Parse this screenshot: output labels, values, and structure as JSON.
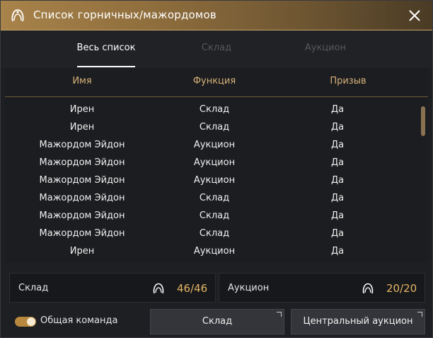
{
  "window": {
    "title": "Список горничных/мажордомов",
    "title_icon": "maid-icon",
    "close_icon": "close-icon"
  },
  "tabs": [
    {
      "label": "Весь список",
      "active": true
    },
    {
      "label": "Склад",
      "active": false
    },
    {
      "label": "Аукцион",
      "active": false
    }
  ],
  "table": {
    "headers": {
      "name": "Имя",
      "function": "Функция",
      "summon": "Призыв"
    },
    "rows": [
      {
        "name": "Ирен",
        "function": "Склад",
        "summon": "Да"
      },
      {
        "name": "Ирен",
        "function": "Склад",
        "summon": "Да"
      },
      {
        "name": "Мажордом Эйдон",
        "function": "Аукцион",
        "summon": "Да"
      },
      {
        "name": "Мажордом Эйдон",
        "function": "Аукцион",
        "summon": "Да"
      },
      {
        "name": "Мажордом Эйдон",
        "function": "Аукцион",
        "summon": "Да"
      },
      {
        "name": "Мажордом Эйдон",
        "function": "Склад",
        "summon": "Да"
      },
      {
        "name": "Мажордом Эйдон",
        "function": "Склад",
        "summon": "Да"
      },
      {
        "name": "Мажордом Эйдон",
        "function": "Склад",
        "summon": "Да"
      },
      {
        "name": "Ирен",
        "function": "Аукцион",
        "summon": "Да"
      }
    ]
  },
  "counters": {
    "warehouse": {
      "label": "Склад",
      "icon": "maid-icon",
      "value": "46/46"
    },
    "auction": {
      "label": "Аукцион",
      "icon": "maid-icon",
      "value": "20/20"
    }
  },
  "bottom": {
    "toggle_label": "Общая команда",
    "toggle_on": true,
    "warehouse_button": "Склад",
    "auction_button": "Центральный аукцион"
  },
  "colors": {
    "accent": "#d6b27a",
    "value": "#e5b565",
    "title_bar": "#a8834a"
  }
}
